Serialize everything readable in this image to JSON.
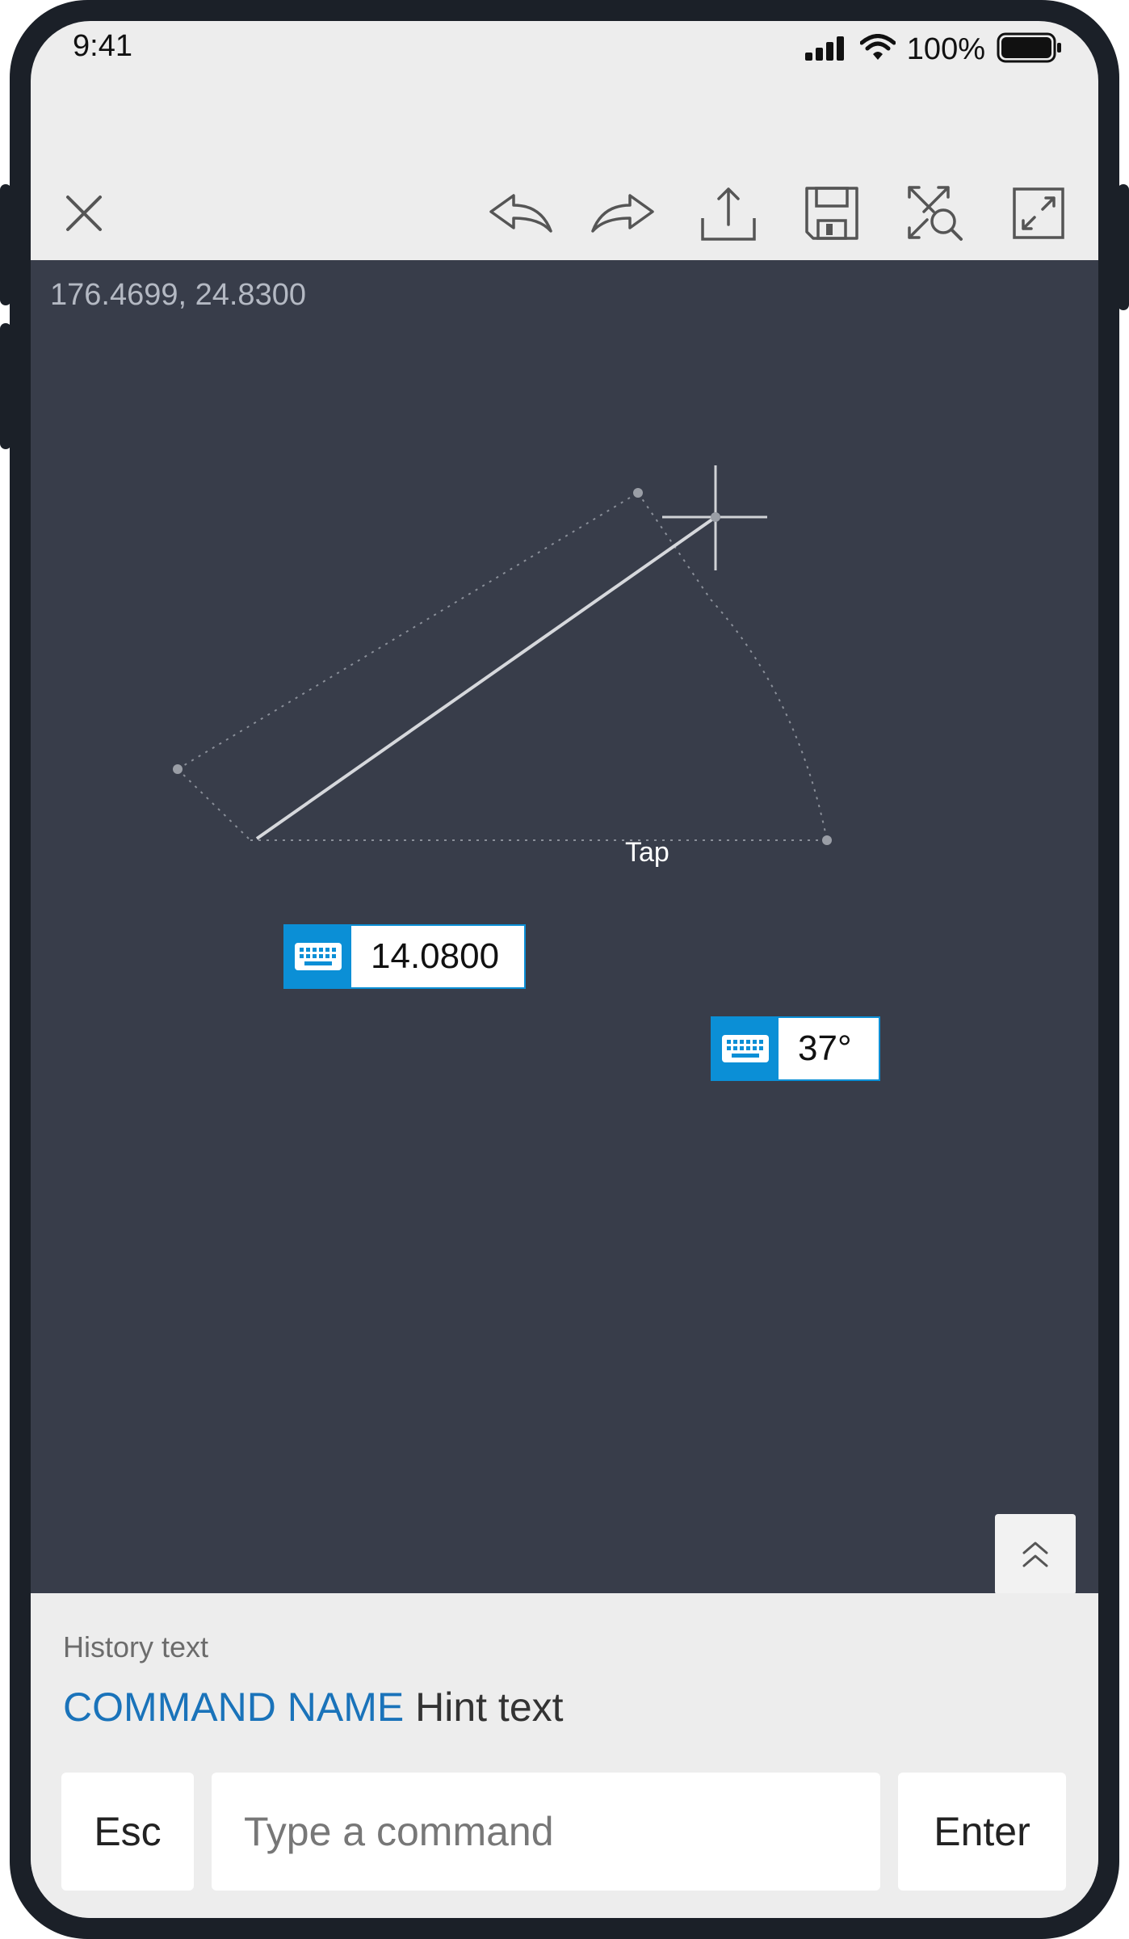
{
  "status_bar": {
    "time": "9:41",
    "battery_percent": "100%"
  },
  "toolbar": {
    "icons": [
      "close-icon",
      "undo-icon",
      "redo-icon",
      "share-upload-icon",
      "save-icon",
      "zoom-extents-icon",
      "fullscreen-icon"
    ]
  },
  "canvas": {
    "coordinates": "176.4699,  24.8300",
    "tap_label": "Tap",
    "length_input": "14.0800",
    "angle_input": "37°",
    "background": "#383d4a",
    "accent": "#0b8fd6"
  },
  "command_bar": {
    "history_text": "History text",
    "command_name": "COMMAND NAME",
    "hint_text": "Hint text",
    "esc_label": "Esc",
    "input_placeholder": "Type a command",
    "enter_label": "Enter",
    "command_name_color": "#1a73ba"
  }
}
